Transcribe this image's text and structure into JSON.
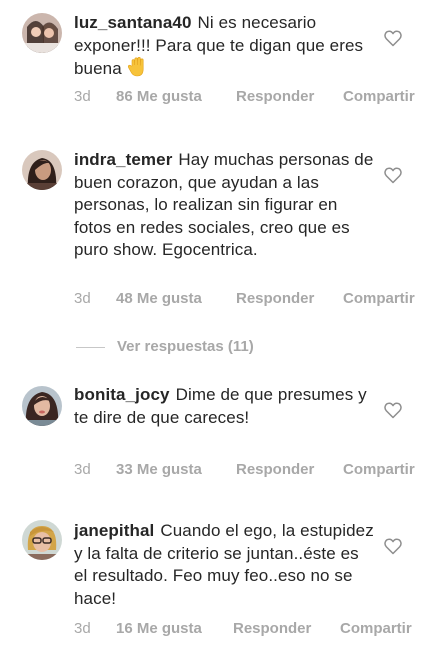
{
  "comments": [
    {
      "username": "luz_santana40",
      "text": "Ni es necesario exponer!!! Para que te digan que eres buena",
      "emoji": "raised-hand-emoji",
      "time": "3d",
      "likes": "86 Me gusta",
      "reply": "Responder",
      "share": "Compartir"
    },
    {
      "username": "indra_temer",
      "text": "Hay muchas personas de buen corazon, que ayudan a las personas, lo realizan sin figurar en fotos en redes sociales, creo que es puro show. Egocentrica.",
      "time": "3d",
      "likes": "48 Me gusta",
      "reply": "Responder",
      "share": "Compartir"
    },
    {
      "username": "bonita_jocy",
      "text": "Dime de que presumes y te dire de que careces!",
      "time": "3d",
      "likes": "33 Me gusta",
      "reply": "Responder",
      "share": "Compartir"
    },
    {
      "username": "janepithal",
      "text": "Cuando el ego, la estupidez y la falta de criterio se juntan..éste es el resultado. Feo muy feo..eso no se hace!",
      "time": "3d",
      "likes": "16 Me gusta",
      "reply": "Responder",
      "share": "Compartir"
    }
  ],
  "view_replies": "Ver respuestas (11)",
  "colors": {
    "text": "#262626",
    "meta": "#a8a8a8",
    "divider": "#c7c7c7"
  },
  "icons": {
    "like": "heart-outline-icon",
    "avatar": "avatar-photo"
  }
}
